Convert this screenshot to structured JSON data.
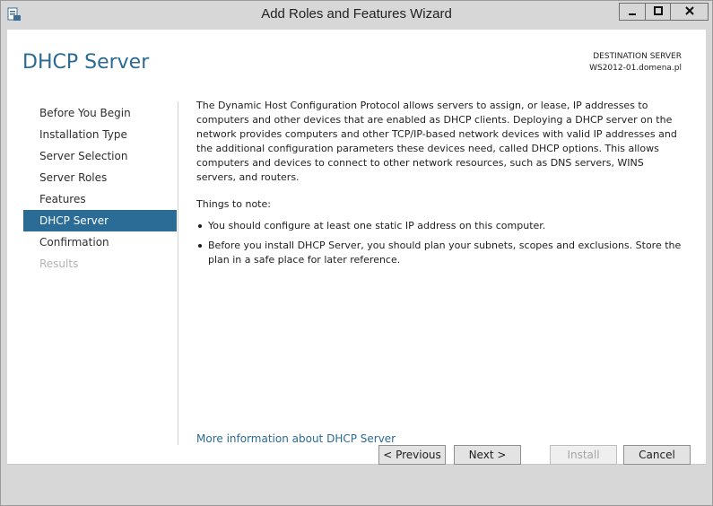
{
  "window": {
    "title": "Add Roles and Features Wizard"
  },
  "header": {
    "page_title": "DHCP Server",
    "destination_label": "DESTINATION SERVER",
    "destination_server": "WS2012-01.domena.pl"
  },
  "nav": {
    "items": [
      {
        "label": "Before You Begin",
        "state": "normal"
      },
      {
        "label": "Installation Type",
        "state": "normal"
      },
      {
        "label": "Server Selection",
        "state": "normal"
      },
      {
        "label": "Server Roles",
        "state": "normal"
      },
      {
        "label": "Features",
        "state": "normal"
      },
      {
        "label": "DHCP Server",
        "state": "active"
      },
      {
        "label": "Confirmation",
        "state": "normal"
      },
      {
        "label": "Results",
        "state": "disabled"
      }
    ]
  },
  "content": {
    "description": "The Dynamic Host Configuration Protocol allows servers to assign, or lease, IP addresses to computers and other devices that are enabled as DHCP clients. Deploying a DHCP server on the network provides computers and other TCP/IP-based network devices with valid IP addresses and the additional configuration parameters these devices need, called DHCP options. This allows computers and devices to connect to other network resources, such as DNS servers, WINS servers, and routers.",
    "notes_heading": "Things to note:",
    "notes": [
      "You should configure at least one static IP address on this computer.",
      "Before you install DHCP Server, you should plan your subnets, scopes and exclusions. Store the plan in a safe place for later reference."
    ],
    "more_info_link": "More information about DHCP Server"
  },
  "footer": {
    "previous_label": "< Previous",
    "next_label": "Next >",
    "install_label": "Install",
    "cancel_label": "Cancel"
  },
  "colors": {
    "accent": "#2a6c96",
    "link": "#2b6a92",
    "chrome": "#d7d7d7"
  }
}
